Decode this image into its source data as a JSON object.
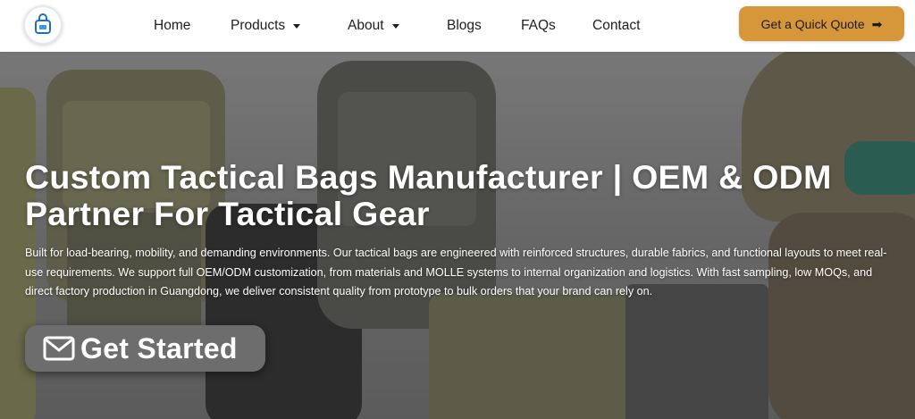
{
  "header": {
    "logo_icon": "bag-logo-icon",
    "nav": [
      {
        "label": "Home",
        "dropdown": false
      },
      {
        "label": "Products",
        "dropdown": true
      },
      {
        "label": "About",
        "dropdown": true
      },
      {
        "label": "Blogs",
        "dropdown": false
      },
      {
        "label": "FAQs",
        "dropdown": false
      },
      {
        "label": "Contact",
        "dropdown": false
      }
    ],
    "quote_button": {
      "label": "Get a Quick Quote",
      "icon": "arrow-right-icon",
      "color": "#d6963a"
    }
  },
  "hero": {
    "title": "Custom Tactical Bags Manufacturer | OEM & ODM Partner For Tactical Gear",
    "description": "Built for load-bearing, mobility, and demanding environments. Our tactical bags are engineered with reinforced structures, durable fabrics, and functional layouts to meet real-use requirements. We support full OEM/ODM customization, from materials and MOLLE systems to internal organization and logistics. With fast sampling, low MOQs, and direct factory production in Guangdong, we deliver consistent quality from prototype to bulk orders that your brand can rely on.",
    "cta": {
      "label": "Get Started",
      "icon": "envelope-icon"
    }
  }
}
